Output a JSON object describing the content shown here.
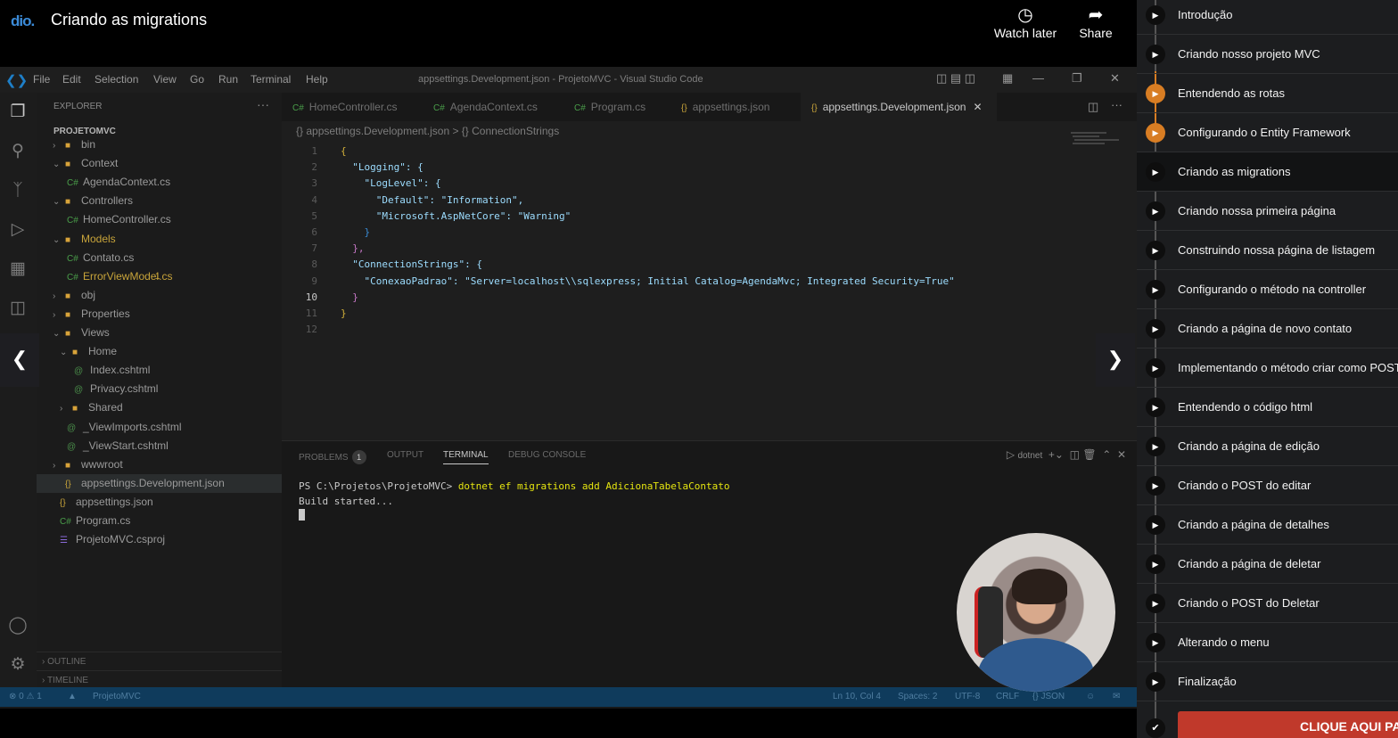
{
  "video": {
    "logo_text": "dio.",
    "title": "Criando as migrations",
    "watch_later_label": "Watch later",
    "share_label": "Share"
  },
  "vscode": {
    "menu": [
      "File",
      "Edit",
      "Selection",
      "View",
      "Go",
      "Run",
      "Terminal",
      "Help"
    ],
    "window_title": "appsettings.Development.json - ProjetoMVC - Visual Studio Code",
    "explorer_header": "EXPLORER",
    "project_name": "PROJETOMVC",
    "tree": [
      {
        "label": "bin",
        "kind": "folder",
        "open": false
      },
      {
        "label": "Context",
        "kind": "folder",
        "open": true
      },
      {
        "label": "AgendaContext.cs",
        "kind": "cs"
      },
      {
        "label": "Controllers",
        "kind": "folder",
        "open": true
      },
      {
        "label": "HomeController.cs",
        "kind": "cs"
      },
      {
        "label": "Models",
        "kind": "folder",
        "open": true
      },
      {
        "label": "Contato.cs",
        "kind": "cs"
      },
      {
        "label": "ErrorViewModel.cs",
        "kind": "cs",
        "badge": "1"
      },
      {
        "label": "obj",
        "kind": "folder",
        "open": false
      },
      {
        "label": "Properties",
        "kind": "folder",
        "open": false
      },
      {
        "label": "Views",
        "kind": "folder",
        "open": true
      },
      {
        "label": "Home",
        "kind": "folder",
        "open": true
      },
      {
        "label": "Index.cshtml",
        "kind": "cshtml"
      },
      {
        "label": "Privacy.cshtml",
        "kind": "cshtml"
      },
      {
        "label": "Shared",
        "kind": "folder",
        "open": false
      },
      {
        "label": "_ViewImports.cshtml",
        "kind": "cshtml"
      },
      {
        "label": "_ViewStart.cshtml",
        "kind": "cshtml"
      },
      {
        "label": "wwwroot",
        "kind": "folder",
        "open": false
      },
      {
        "label": "appsettings.Development.json",
        "kind": "json",
        "selected": true
      },
      {
        "label": "appsettings.json",
        "kind": "json"
      },
      {
        "label": "Program.cs",
        "kind": "cs"
      },
      {
        "label": "ProjetoMVC.csproj",
        "kind": "csproj"
      }
    ],
    "outline_label": "OUTLINE",
    "timeline_label": "TIMELINE",
    "tabs": [
      {
        "label": "HomeController.cs",
        "icon": "C#"
      },
      {
        "label": "AgendaContext.cs",
        "icon": "C#"
      },
      {
        "label": "Program.cs",
        "icon": "C#"
      },
      {
        "label": "appsettings.json",
        "icon": "{}"
      },
      {
        "label": "appsettings.Development.json",
        "icon": "{}",
        "active": true
      }
    ],
    "breadcrumb": "{} appsettings.Development.json  >  {} ConnectionStrings",
    "code": [
      "{",
      "  \"Logging\": {",
      "    \"LogLevel\": {",
      "      \"Default\": \"Information\",",
      "      \"Microsoft.AspNetCore\": \"Warning\"",
      "    }",
      "  },",
      "  \"ConnectionStrings\": {",
      "    \"ConexaoPadrao\": \"Server=localhost\\\\sqlexpress; Initial Catalog=AgendaMvc; Integrated Security=True\"",
      "  }",
      "}",
      ""
    ],
    "panel_tabs": [
      "PROBLEMS",
      "OUTPUT",
      "TERMINAL",
      "DEBUG CONSOLE"
    ],
    "problems_count": "1",
    "terminal_shell": "dotnet",
    "terminal": {
      "prompt": "PS C:\\Projetos\\ProjetoMVC> ",
      "command": "dotnet ef migrations add AdicionaTabelaContato",
      "output": "Build started..."
    },
    "status": {
      "problems": "⊗ 0 ⚠ 1",
      "folder": "ProjetoMVC",
      "position": "Ln 10, Col 4",
      "spaces": "Spaces: 2",
      "encoding": "UTF-8",
      "eol": "CRLF",
      "language": "{} JSON"
    }
  },
  "playlist": {
    "lessons": [
      {
        "title": "Introdução",
        "state": "default"
      },
      {
        "title": "Criando nosso projeto MVC",
        "state": "default"
      },
      {
        "title": "Entendendo as rotas",
        "state": "watched"
      },
      {
        "title": "Configurando o Entity Framework",
        "state": "watched"
      },
      {
        "title": "Criando as migrations",
        "state": "current"
      },
      {
        "title": "Criando nossa primeira página",
        "state": "default"
      },
      {
        "title": "Construindo nossa página de listagem",
        "state": "default"
      },
      {
        "title": "Configurando o método na controller",
        "state": "default"
      },
      {
        "title": "Criando a página de novo contato",
        "state": "default"
      },
      {
        "title": "Implementando o método criar como POST",
        "state": "default"
      },
      {
        "title": "Entendendo o código html",
        "state": "default"
      },
      {
        "title": "Criando a página de edição",
        "state": "default"
      },
      {
        "title": "Criando o POST do editar",
        "state": "default"
      },
      {
        "title": "Criando a página de detalhes",
        "state": "default"
      },
      {
        "title": "Criando a página de deletar",
        "state": "default"
      },
      {
        "title": "Criando o POST do Deletar",
        "state": "default"
      },
      {
        "title": "Alterando o menu",
        "state": "default"
      },
      {
        "title": "Finalização",
        "state": "default"
      }
    ],
    "cta_label": "CLIQUE AQUI PA",
    "accent_color": "#d87d23",
    "cta_color": "#c0392b"
  }
}
